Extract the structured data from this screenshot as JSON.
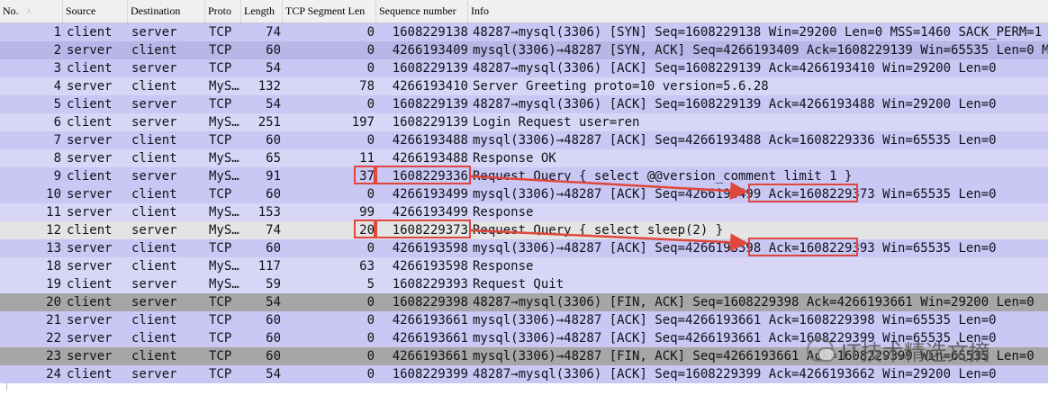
{
  "columns": {
    "no": "No.",
    "source": "Source",
    "destination": "Destination",
    "protocol": "Proto",
    "length": "Length",
    "tcp_segment_len": "TCP Segment Len",
    "sequence_number": "Sequence number",
    "info": "Info"
  },
  "packets": [
    {
      "no": "1",
      "src": "client",
      "dst": "server",
      "proto": "TCP",
      "len": "74",
      "seg": "0",
      "seq": "1608229138",
      "info": "48287→mysql(3306) [SYN] Seq=1608229138 Win=29200 Len=0 MSS=1460 SACK_PERM=1 TSval"
    },
    {
      "no": "2",
      "src": "server",
      "dst": "client",
      "proto": "TCP",
      "len": "60",
      "seg": "0",
      "seq": "4266193409",
      "info": "mysql(3306)→48287 [SYN, ACK] Seq=4266193409 Ack=1608229139 Win=65535 Len=0 MSS=1"
    },
    {
      "no": "3",
      "src": "client",
      "dst": "server",
      "proto": "TCP",
      "len": "54",
      "seg": "0",
      "seq": "1608229139",
      "info": "48287→mysql(3306) [ACK] Seq=1608229139 Ack=4266193410 Win=29200 Len=0"
    },
    {
      "no": "4",
      "src": "server",
      "dst": "client",
      "proto": "MyS…",
      "len": "132",
      "seg": "78",
      "seq": "4266193410",
      "info": "Server Greeting proto=10 version=5.6.28"
    },
    {
      "no": "5",
      "src": "client",
      "dst": "server",
      "proto": "TCP",
      "len": "54",
      "seg": "0",
      "seq": "1608229139",
      "info": "48287→mysql(3306) [ACK] Seq=1608229139 Ack=4266193488 Win=29200 Len=0"
    },
    {
      "no": "6",
      "src": "client",
      "dst": "server",
      "proto": "MyS…",
      "len": "251",
      "seg": "197",
      "seq": "1608229139",
      "info": "Login Request user=ren"
    },
    {
      "no": "7",
      "src": "server",
      "dst": "client",
      "proto": "TCP",
      "len": "60",
      "seg": "0",
      "seq": "4266193488",
      "info": "mysql(3306)→48287 [ACK] Seq=4266193488 Ack=1608229336 Win=65535 Len=0"
    },
    {
      "no": "8",
      "src": "server",
      "dst": "client",
      "proto": "MyS…",
      "len": "65",
      "seg": "11",
      "seq": "4266193488",
      "info": "Response OK"
    },
    {
      "no": "9",
      "src": "client",
      "dst": "server",
      "proto": "MyS…",
      "len": "91",
      "seg": "37",
      "seq": "1608229336",
      "info": "Request Query { select @@version_comment limit 1 }"
    },
    {
      "no": "10",
      "src": "server",
      "dst": "client",
      "proto": "TCP",
      "len": "60",
      "seg": "0",
      "seq": "4266193499",
      "info": "mysql(3306)→48287 [ACK] Seq=4266193499 Ack=1608229373 Win=65535 Len=0"
    },
    {
      "no": "11",
      "src": "server",
      "dst": "client",
      "proto": "MyS…",
      "len": "153",
      "seg": "99",
      "seq": "4266193499",
      "info": "Response"
    },
    {
      "no": "12",
      "src": "client",
      "dst": "server",
      "proto": "MyS…",
      "len": "74",
      "seg": "20",
      "seq": "1608229373",
      "info": "Request Query { select sleep(2) }"
    },
    {
      "no": "13",
      "src": "server",
      "dst": "client",
      "proto": "TCP",
      "len": "60",
      "seg": "0",
      "seq": "4266193598",
      "info": "mysql(3306)→48287 [ACK] Seq=4266193598 Ack=1608229393 Win=65535 Len=0"
    },
    {
      "no": "18",
      "src": "server",
      "dst": "client",
      "proto": "MyS…",
      "len": "117",
      "seg": "63",
      "seq": "4266193598",
      "info": "Response"
    },
    {
      "no": "19",
      "src": "client",
      "dst": "server",
      "proto": "MyS…",
      "len": "59",
      "seg": "5",
      "seq": "1608229393",
      "info": "Request Quit"
    },
    {
      "no": "20",
      "src": "client",
      "dst": "server",
      "proto": "TCP",
      "len": "54",
      "seg": "0",
      "seq": "1608229398",
      "info": "48287→mysql(3306) [FIN, ACK] Seq=1608229398 Ack=4266193661 Win=29200 Len=0"
    },
    {
      "no": "21",
      "src": "server",
      "dst": "client",
      "proto": "TCP",
      "len": "60",
      "seg": "0",
      "seq": "4266193661",
      "info": "mysql(3306)→48287 [ACK] Seq=4266193661 Ack=1608229398 Win=65535 Len=0"
    },
    {
      "no": "22",
      "src": "server",
      "dst": "client",
      "proto": "TCP",
      "len": "60",
      "seg": "0",
      "seq": "4266193661",
      "info": "mysql(3306)→48287 [ACK] Seq=4266193661 Ack=1608229399 Win=65535 Len=0"
    },
    {
      "no": "23",
      "src": "server",
      "dst": "client",
      "proto": "TCP",
      "len": "60",
      "seg": "0",
      "seq": "4266193661",
      "info": "mysql(3306)→48287 [FIN, ACK] Seq=4266193661 Ack=1608229399 Win=65535 Len=0"
    },
    {
      "no": "24",
      "src": "client",
      "dst": "server",
      "proto": "TCP",
      "len": "54",
      "seg": "0",
      "seq": "1608229399",
      "info": "48287→mysql(3306) [ACK] Seq=1608229399 Ack=4266193662 Win=29200 Len=0"
    }
  ],
  "row_styles": [
    "even",
    "sel",
    "even",
    "odd",
    "even",
    "odd",
    "even",
    "odd",
    "even",
    "even",
    "odd",
    "light",
    "even",
    "odd",
    "odd",
    "dark",
    "even",
    "even",
    "dark",
    "even"
  ],
  "watermark": {
    "text": "IT技术精选文摘"
  },
  "colors": {
    "highlight_box": "#e0473c",
    "tcp_row": "#c9c7f4",
    "mysql_row": "#d7d6f7",
    "dark_row": "#a6a6a6"
  }
}
